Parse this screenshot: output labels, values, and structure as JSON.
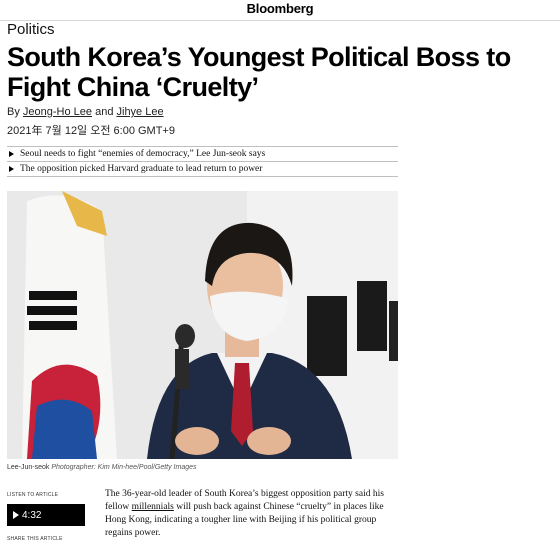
{
  "header": {
    "brand": "Bloomberg"
  },
  "article": {
    "section": "Politics",
    "headline": "South Korea’s Youngest Political Boss to Fight China ‘Cruelty’",
    "byline": {
      "prefix": "By",
      "author1": "Jeong-Ho Lee",
      "conjunction": "and",
      "author2": "Jihye Lee"
    },
    "date": "2021年 7월 12일 오전 6:00 GMT+9",
    "bullets": [
      "Seoul needs to fight “enemies of democracy,” Lee Jun-seok says",
      "The opposition picked Harvard graduate to lead return to power"
    ],
    "photo": {
      "caption_subject": "Lee-Jun-seok",
      "caption_credit": "Photographer: Kim Min-hee/Pool/Getty Images"
    },
    "listen": {
      "label": "LISTEN TO ARTICLE",
      "duration": "4:32"
    },
    "share": {
      "label": "SHARE THIS ARTICLE"
    },
    "body": {
      "part1": "The 36-year-old leader of South Korea’s biggest opposition party said his fellow ",
      "link": "millennials",
      "part2": " will push back against Chinese “cruelty” in places like Hong Kong, indicating a tougher line with Beijing if his political group regains power."
    }
  }
}
